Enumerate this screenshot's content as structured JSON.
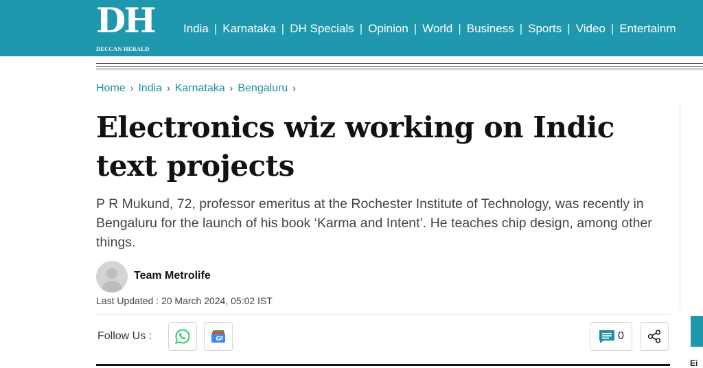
{
  "logo": {
    "mark": "DH",
    "name": "DECCAN HERALD"
  },
  "nav": [
    {
      "label": "India"
    },
    {
      "label": "Karnataka"
    },
    {
      "label": "DH Specials"
    },
    {
      "label": "Opinion"
    },
    {
      "label": "World"
    },
    {
      "label": "Business"
    },
    {
      "label": "Sports"
    },
    {
      "label": "Video"
    },
    {
      "label": "Entertainm"
    }
  ],
  "breadcrumb": [
    "Home",
    "India",
    "Karnataka",
    "Bengaluru"
  ],
  "article": {
    "headline": "Electronics wiz working on Indic text projects",
    "summary": "P R Mukund, 72, professor emeritus at the Rochester Institute of Technology, was recently in Bengaluru for the launch of his book ‘Karma and Intent’. He teaches chip design, among other things.",
    "author": "Team Metrolife",
    "last_updated": "Last Updated : 20 March 2024, 05:02 IST"
  },
  "share": {
    "follow_label": "Follow Us :",
    "comment_count": "0"
  },
  "sidebar": {
    "partial_text": "Ei"
  },
  "colors": {
    "brand": "#1f98ad",
    "link": "#1f8fa3",
    "whatsapp": "#25d366"
  },
  "icons": [
    "whatsapp-icon",
    "google-news-icon",
    "comment-icon",
    "share-icon",
    "user-avatar-icon"
  ]
}
